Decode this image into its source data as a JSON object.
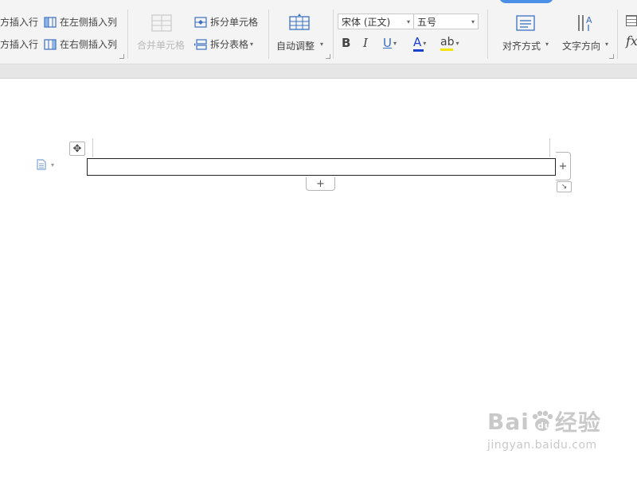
{
  "ribbon": {
    "row_above_label": "方插入行",
    "row_below_label": "方插入行",
    "insert_col_left_label": "在左侧插入列",
    "insert_col_right_label": "在右侧插入列",
    "merge_cells_label": "合并单元格",
    "split_cells_label": "拆分单元格",
    "split_table_label": "拆分表格",
    "auto_adjust_label": "自动调整",
    "font_name": "宋体 (正文)",
    "font_size": "五号",
    "bold": "B",
    "italic": "I",
    "underline": "U",
    "font_color": "A",
    "highlight": "ab",
    "align_label": "对齐方式",
    "text_direction_label": "文字方向",
    "formula_label": "fx",
    "font_color_hex": "#1a3fd1",
    "highlight_color_hex": "#f5e400",
    "accent_hex": "#4c8fe6"
  },
  "document": {
    "add_row_symbol": "+",
    "add_col_symbol": "+",
    "move_symbol": "✥",
    "resize_symbol": "↘"
  },
  "watermark": {
    "brand": "Bai",
    "brand_tail": "du",
    "product": "经验",
    "url": "jingyan.baidu.com"
  }
}
